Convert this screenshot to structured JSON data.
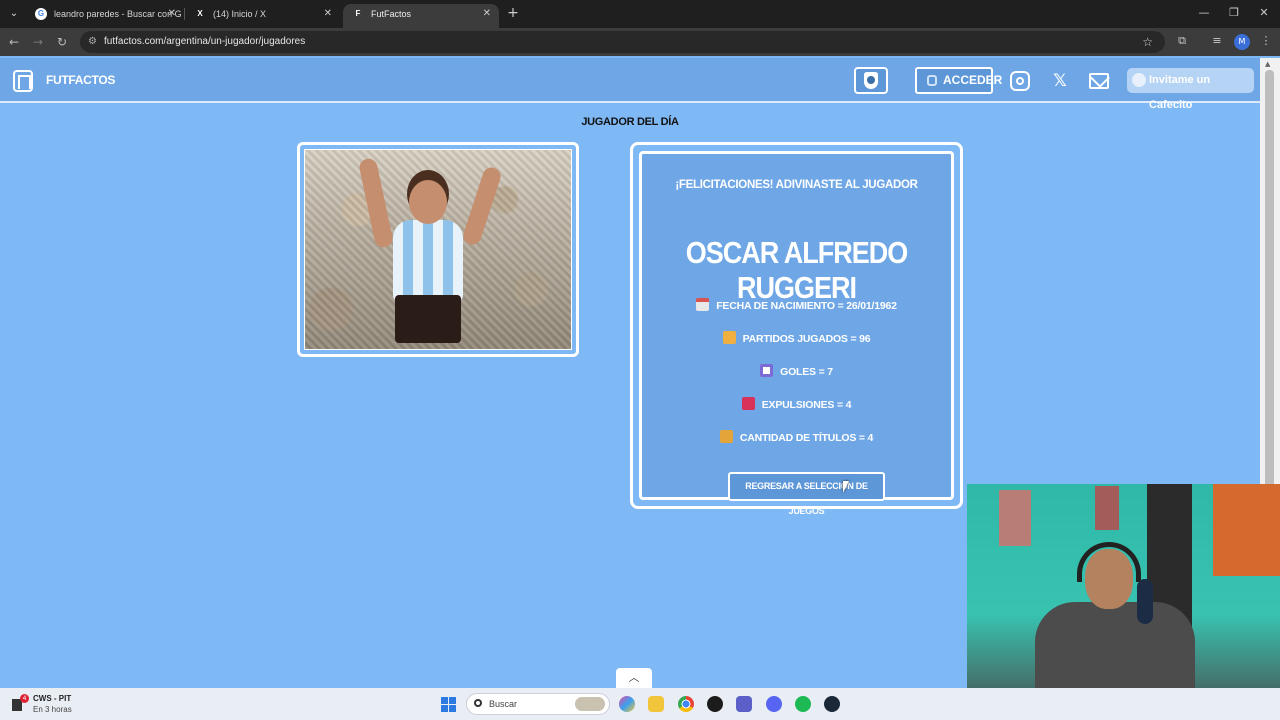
{
  "browser": {
    "tabs": [
      {
        "title": "leandro paredes - Buscar con G",
        "favicon": "G",
        "active": false
      },
      {
        "title": "(14) Inicio / X",
        "favicon": "X",
        "active": false
      },
      {
        "title": "FutFactos",
        "favicon": "F",
        "active": true
      }
    ],
    "url": "futfactos.com/argentina/un-jugador/jugadores",
    "profile_initial": "M"
  },
  "header": {
    "site_name": "FUTFACTOS",
    "login_label": "ACCEDER",
    "cafecito_label": "Invitame un Cafecito"
  },
  "main": {
    "section_title": "JUGADOR DEL DÍA",
    "congrats": "¡FELICITACIONES! ADIVINASTE AL JUGADOR",
    "player_name": "OSCAR ALFREDO RUGGERI",
    "stats": [
      {
        "icon": "calendar-icon",
        "text": "FECHA DE NACIMIENTO = 26/01/1962"
      },
      {
        "icon": "boot-icon",
        "text": "PARTIDOS JUGADOS = 96"
      },
      {
        "icon": "ball-icon",
        "text": "GOLES = 7"
      },
      {
        "icon": "red-card-icon",
        "text": "EXPULSIONES = 4"
      },
      {
        "icon": "trophy-icon",
        "text": "CANTIDAD DE TÍTULOS = 4"
      }
    ],
    "back_button_label": "REGRESAR A SELECCIÓN DE JUEGOS"
  },
  "taskbar": {
    "weather_title": "CWS - PIT",
    "weather_sub": "En 3 horas",
    "notification_count": "4",
    "search_placeholder": "Buscar"
  },
  "colors": {
    "page_bg": "#7eb8f5",
    "header_bg": "#6fa7e6",
    "red_card": "#d8325a"
  }
}
